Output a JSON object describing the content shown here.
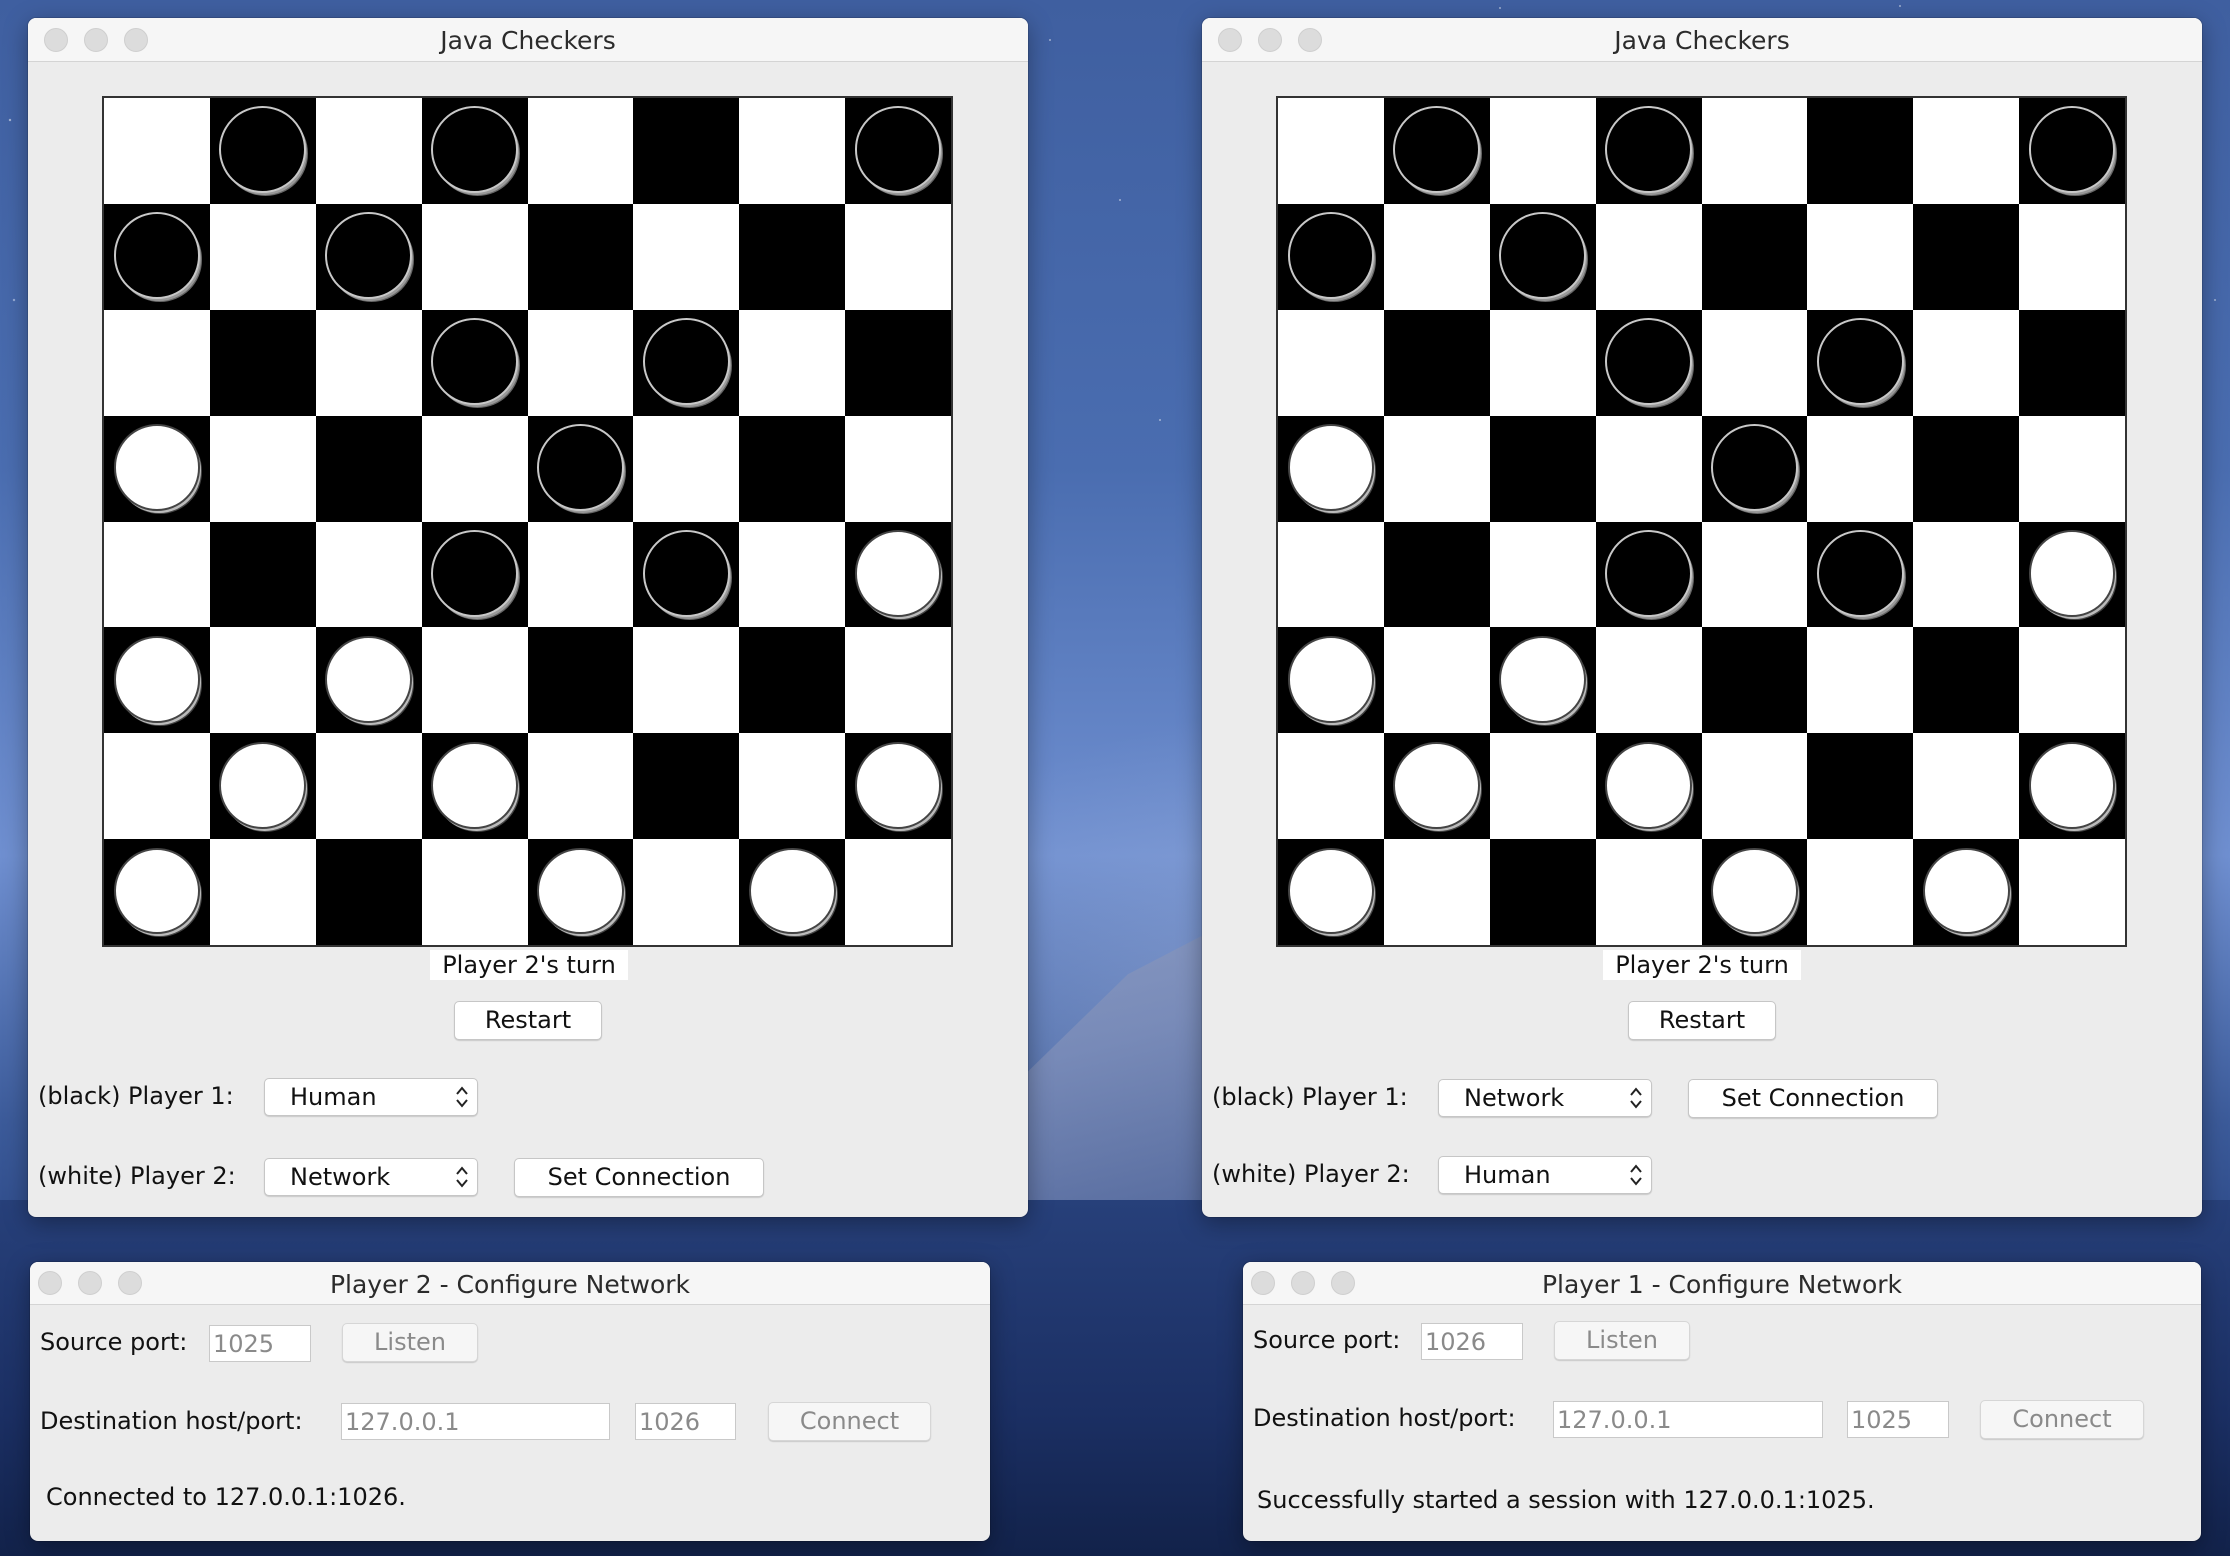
{
  "board_layout": [
    [
      "",
      "B",
      "",
      "B",
      "",
      "",
      "",
      "B"
    ],
    [
      "B",
      "",
      "B",
      "",
      "",
      "",
      "",
      ""
    ],
    [
      "",
      "",
      "",
      "B",
      "",
      "B",
      "",
      ""
    ],
    [
      "W",
      "",
      "",
      "",
      "B",
      "",
      "",
      ""
    ],
    [
      "",
      "",
      "",
      "B",
      "",
      "B",
      "",
      "W"
    ],
    [
      "W",
      "",
      "W",
      "",
      "",
      "",
      "",
      ""
    ],
    [
      "",
      "W",
      "",
      "W",
      "",
      "",
      "",
      "W"
    ],
    [
      "W",
      "",
      "",
      "",
      "W",
      "",
      "W",
      ""
    ]
  ],
  "windows": {
    "left_game": {
      "title": "Java Checkers",
      "status": "Player 2's turn",
      "restart_label": "Restart",
      "player1_label": "(black) Player 1:",
      "player1_value": "Human",
      "player2_label": "(white) Player 2:",
      "player2_value": "Network",
      "set_connection_label": "Set Connection"
    },
    "right_game": {
      "title": "Java Checkers",
      "status": "Player 2's turn",
      "restart_label": "Restart",
      "player1_label": "(black) Player 1:",
      "player1_value": "Network",
      "player2_label": "(white) Player 2:",
      "player2_value": "Human",
      "set_connection_label": "Set Connection"
    },
    "left_network": {
      "title": "Player 2 - Configure Network",
      "source_port_label": "Source port:",
      "source_port_value": "1025",
      "listen_label": "Listen",
      "dest_label": "Destination host/port:",
      "dest_host_value": "127.0.0.1",
      "dest_port_value": "1026",
      "connect_label": "Connect",
      "status": "Connected to 127.0.0.1:1026."
    },
    "right_network": {
      "title": "Player 1 - Configure Network",
      "source_port_label": "Source port:",
      "source_port_value": "1026",
      "listen_label": "Listen",
      "dest_label": "Destination host/port:",
      "dest_host_value": "127.0.0.1",
      "dest_port_value": "1025",
      "connect_label": "Connect",
      "status": "Successfully started a session with 127.0.0.1:1025."
    }
  },
  "colors": {
    "window_bg": "#ececec",
    "titlebar_bg": "#f6f6f6",
    "dark_square": "#000000",
    "light_square": "#ffffff",
    "disabled_text": "#8a8a8a"
  }
}
